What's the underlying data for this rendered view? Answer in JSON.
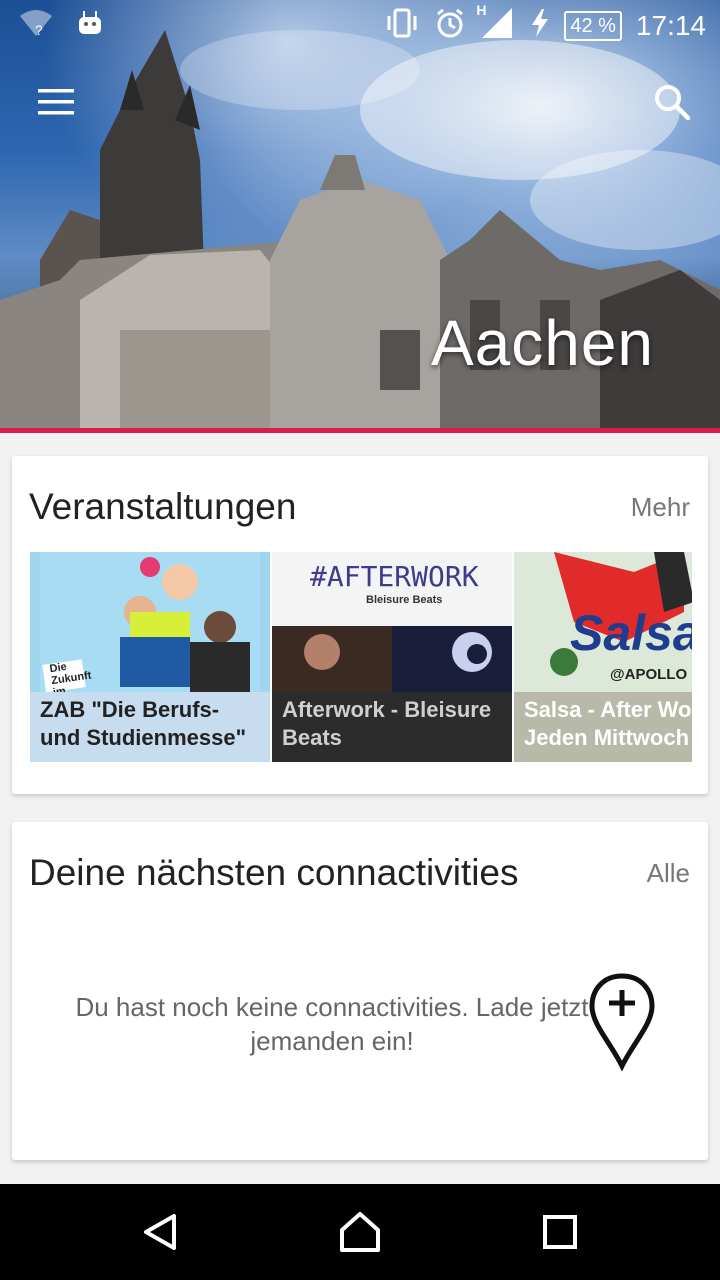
{
  "status_bar": {
    "time": "17:14",
    "battery": "42 %",
    "network_type": "H",
    "icons": [
      "wifi-question-icon",
      "android-icon",
      "vibrate-icon",
      "alarm-icon",
      "signal-icon",
      "charging-icon",
      "battery-icon"
    ]
  },
  "header": {
    "city": "Aachen",
    "menu_icon": "hamburger-menu-icon",
    "search_icon": "search-icon",
    "accent_color": "#d81e4b"
  },
  "events_card": {
    "title": "Veranstaltungen",
    "more_label": "Mehr",
    "events": [
      {
        "caption": "ZAB \"Die Berufs- und Studienmesse\"",
        "poster_text": "Die Zukunft im Visier!",
        "caption_bg": "#c8dcef",
        "poster_bg": "#9fd6ee"
      },
      {
        "caption": "Afterwork - Bleisure Beats",
        "poster_text": "#AFTERWORK",
        "poster_sub": "Bleisure Beats",
        "caption_bg": "#2c2c2c",
        "poster_bg": "#f1f1f1"
      },
      {
        "caption": "Salsa - After Work Jeden Mittwoch",
        "poster_text": "Salsa",
        "poster_sub": "@APOLLO",
        "caption_bg": "#b9b9a9",
        "poster_bg": "#d8e6d4"
      }
    ]
  },
  "connectivities_card": {
    "title": "Deine nächsten connactivities",
    "all_label": "Alle",
    "empty_message": "Du hast noch keine connactivities. Lade jetzt jemanden ein!",
    "add_icon": "add-location-pin-icon"
  },
  "nav_bar": {
    "icons": [
      "back-icon",
      "home-icon",
      "recents-icon"
    ]
  }
}
